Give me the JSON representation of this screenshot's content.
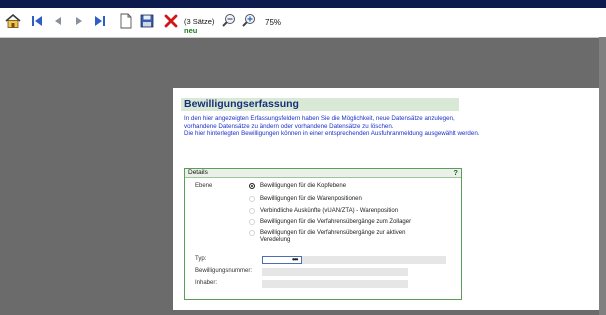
{
  "toolbar": {
    "record_count": "(3 Sätze)",
    "record_status": "neu",
    "zoom": "75%",
    "icons": [
      "home-icon",
      "first-record-icon",
      "previous-record-icon",
      "next-record-icon",
      "last-record-icon",
      "new-document-icon",
      "save-icon",
      "delete-icon",
      "zoom-out-icon",
      "zoom-in-icon"
    ]
  },
  "page": {
    "title": "Bewilligungserfassung",
    "intro_lines": [
      "In den hier angezeigten Erfassungsfeldern haben Sie die Möglichkeit, neue Datensätze anzulegen,",
      "vorhandene Datensätze zu ändern oder vorhandene Datensätze zu löschen.",
      "Die hier hinterlegten Bewilligungen können in einer entsprechenden Ausfuhranmeldung ausgewählt werden."
    ]
  },
  "details": {
    "label": "Details",
    "help": "?",
    "ebene_label": "Ebene",
    "options": [
      "Bewilligungen für die Kopfebene",
      "Bewilligungen für die Warenpositionen",
      "Verbindliche Auskünfte (vUAN/ZTA) - Warenposition",
      "Bewilligungen für die Verfahrensübergänge zum Zollager",
      "Bewilligungen für die Verfahrensübergänge zur aktiven",
      "Veredelung"
    ],
    "selected_option": "Bewilligungen für die Kopfebene",
    "typ_label": "Typ:",
    "typ_button": "•••",
    "nummer_label": "Bewilligungsnummer:",
    "inhaber_label": "Inhaber:"
  },
  "colors": {
    "title_text": "#1a2e7a",
    "intro_text": "#1a31c8",
    "details_border": "#5c9d59",
    "record_status": "#1f7a1f"
  }
}
